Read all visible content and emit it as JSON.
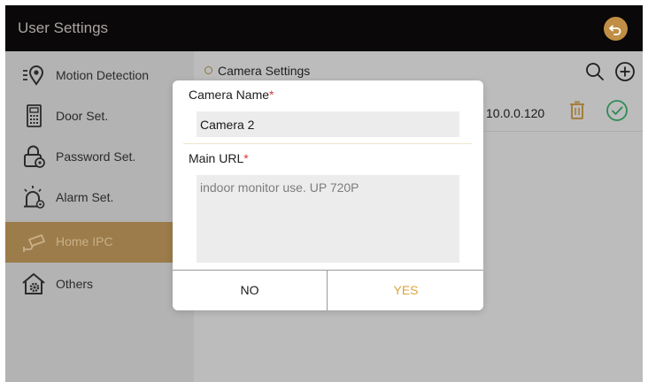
{
  "app": {
    "title": "User Settings"
  },
  "sidebar": {
    "items": [
      {
        "label": "Motion Detection",
        "icon": "motion-detection-icon"
      },
      {
        "label": "Door Set.",
        "icon": "door-panel-icon"
      },
      {
        "label": "Password Set.",
        "icon": "lock-icon"
      },
      {
        "label": "Alarm Set.",
        "icon": "alarm-icon"
      },
      {
        "label": "Home IPC",
        "icon": "camera-icon",
        "active": true
      },
      {
        "label": "Others",
        "icon": "home-gear-icon"
      }
    ]
  },
  "main": {
    "breadcrumb": "Camera Settings",
    "list": [
      {
        "ip": "10.0.0.120"
      }
    ]
  },
  "dialog": {
    "name_label": "Camera Name",
    "name_value": "Camera 2",
    "url_label": "Main URL",
    "url_value": "indoor monitor use. UP 720P",
    "required_mark": "*",
    "no_label": "NO",
    "yes_label": "YES"
  },
  "colors": {
    "titlebar": "#0a0808",
    "accent": "#c08f45",
    "active_item": "#9c7c4a",
    "required": "#d43b3b",
    "confirm": "#d9a53f"
  }
}
